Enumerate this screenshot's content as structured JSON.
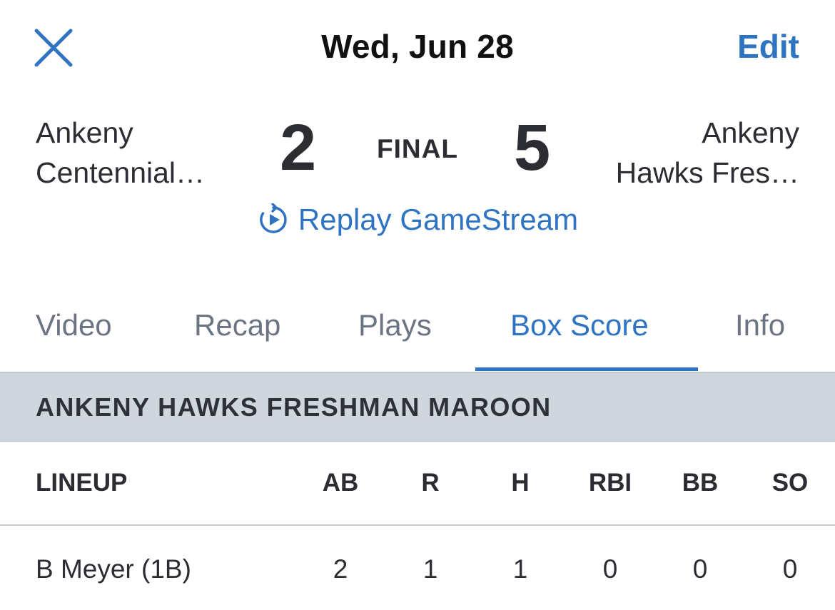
{
  "header": {
    "title": "Wed, Jun 28",
    "edit_label": "Edit",
    "close_icon": "close-icon"
  },
  "game": {
    "away_team": [
      "Ankeny",
      "Centennial…"
    ],
    "home_team": [
      "Ankeny",
      "Hawks Fres…"
    ],
    "away_score": "2",
    "home_score": "5",
    "status": "FINAL",
    "replay_label": "Replay GameStream",
    "replay_icon": "replay-icon"
  },
  "tabs": [
    {
      "label": "Video",
      "active": false
    },
    {
      "label": "Recap",
      "active": false
    },
    {
      "label": "Plays",
      "active": false
    },
    {
      "label": "Box Score",
      "active": true
    },
    {
      "label": "Info",
      "active": false
    }
  ],
  "box_score": {
    "team_name": "ANKENY HAWKS FRESHMAN MAROON",
    "columns": [
      "LINEUP",
      "AB",
      "R",
      "H",
      "RBI",
      "BB",
      "SO"
    ],
    "rows": [
      {
        "player": "B Meyer (1B)",
        "ab": "2",
        "r": "1",
        "h": "1",
        "rbi": "0",
        "bb": "0",
        "so": "0"
      }
    ]
  },
  "colors": {
    "accent": "#2f74c2",
    "inactive_tab": "#6a7482",
    "band": "#d0d6de",
    "text": "#2b2d33"
  }
}
